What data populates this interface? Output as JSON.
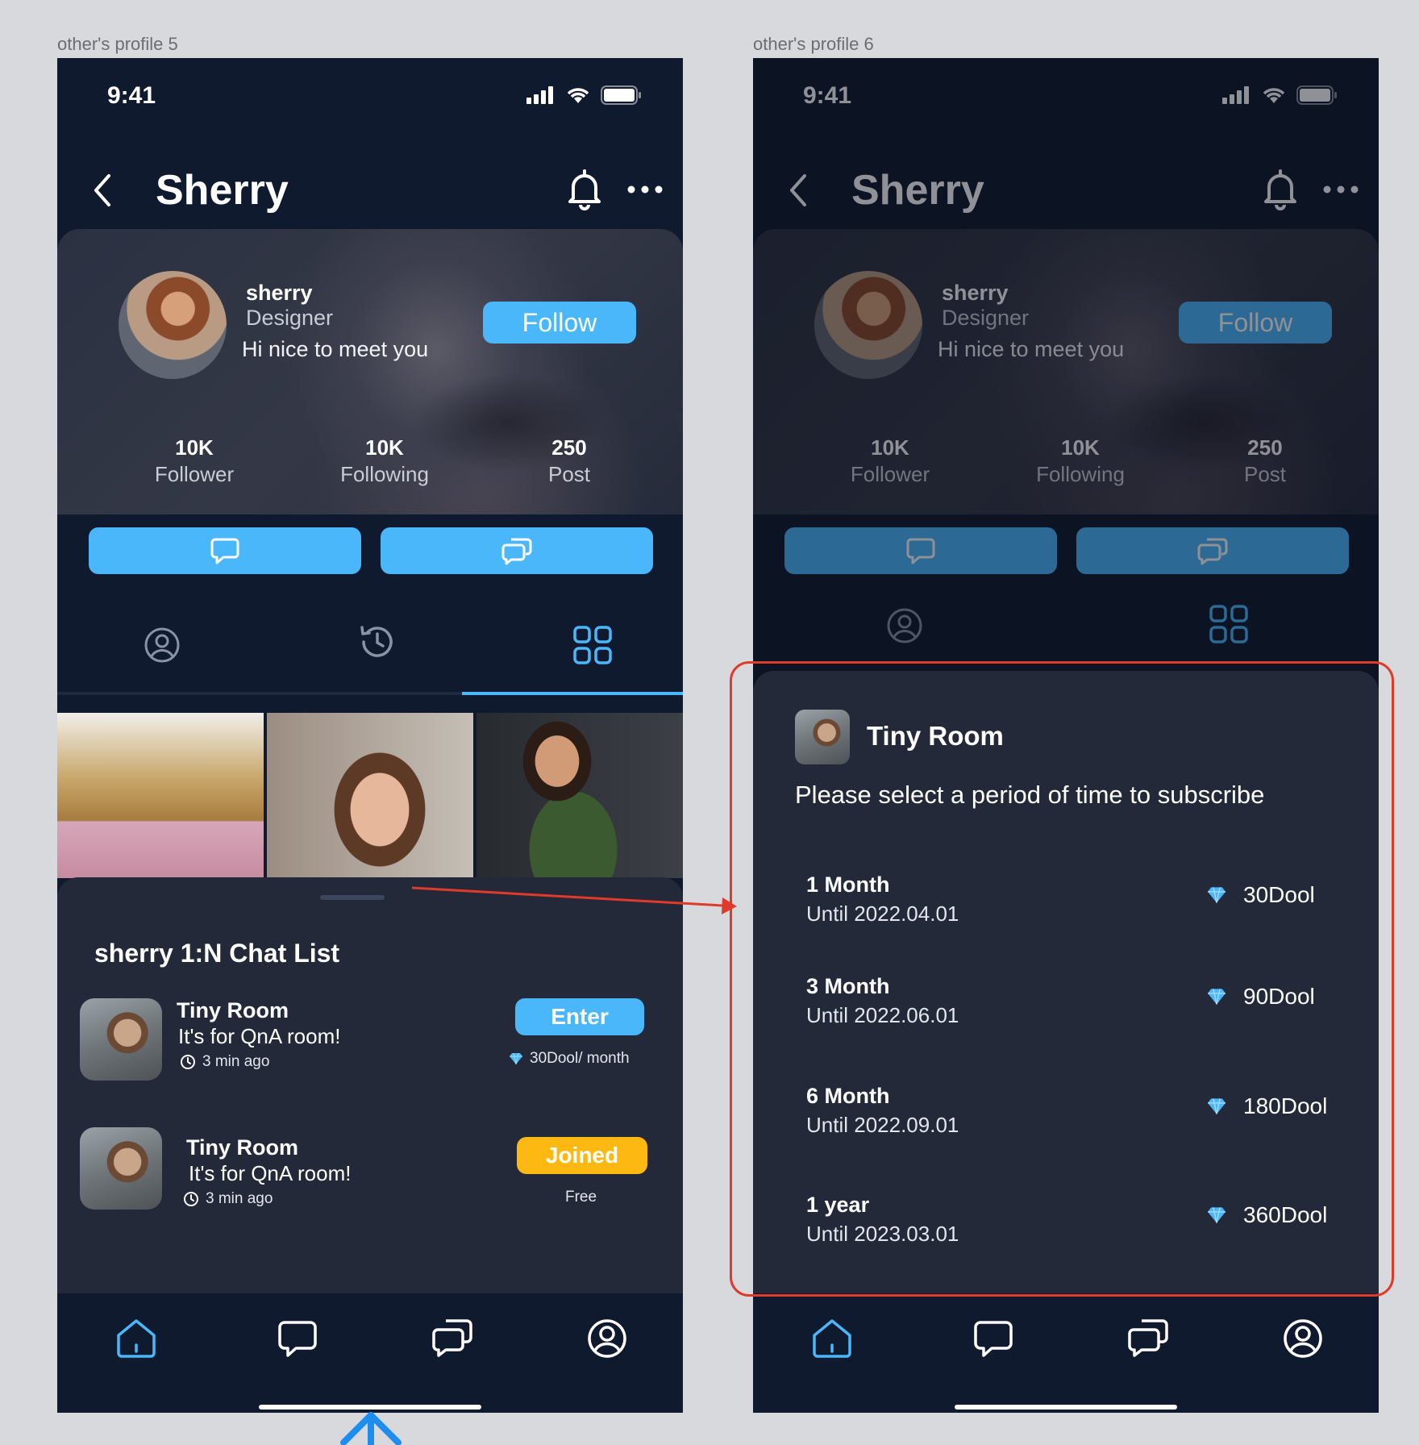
{
  "frames": {
    "left_label": "other's profile 5",
    "right_label": "other's profile 6"
  },
  "status": {
    "time": "9:41"
  },
  "header": {
    "title": "Sherry"
  },
  "profile": {
    "username": "sherry",
    "role": "Designer",
    "bio": "Hi nice to meet you",
    "follow_label": "Follow",
    "stats": [
      {
        "value": "10K",
        "label": "Follower"
      },
      {
        "value": "10K",
        "label": "Following"
      },
      {
        "value": "250",
        "label": "Post"
      }
    ]
  },
  "chat_list": {
    "title": "sherry 1:N Chat List",
    "rooms": [
      {
        "name": "Tiny Room",
        "desc": "It's for QnA room!",
        "time": "3 min ago",
        "action": "Enter",
        "price": "30Dool/ month"
      },
      {
        "name": "Tiny Room",
        "desc": "It's for QnA room!",
        "time": "3 min ago",
        "action": "Joined",
        "price": "Free"
      }
    ]
  },
  "subscription": {
    "room_name": "Tiny Room",
    "prompt": "Please select a period of time to subscribe",
    "plans": [
      {
        "name": "1 Month",
        "until": "Until 2022.04.01",
        "price": "30Dool"
      },
      {
        "name": "3 Month",
        "until": "Until 2022.06.01",
        "price": "90Dool"
      },
      {
        "name": "6 Month",
        "until": "Until 2022.09.01",
        "price": "180Dool"
      },
      {
        "name": "1  year",
        "until": "Until 2023.03.01",
        "price": "360Dool"
      }
    ]
  },
  "colors": {
    "accent": "#4ab7fb",
    "joined": "#fdb912",
    "background": "#101a2e",
    "sheet": "#232938",
    "highlight": "#e03b2a"
  },
  "icons": [
    "back-icon",
    "bell-icon",
    "more-icon",
    "chat-icon",
    "group-chat-icon",
    "profile-icon",
    "history-icon",
    "grid-icon",
    "home-icon",
    "clock-icon",
    "diamond-icon"
  ]
}
